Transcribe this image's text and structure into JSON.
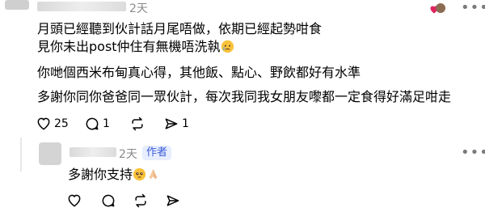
{
  "comment": {
    "time": "2天",
    "lines": [
      "月頭已經聽到伙計話月尾唔做，依期已經起勢咁食",
      "見你未出post仲住有無機唔洗執",
      "你哋個西米布甸真心得，其他飯、點心、野飲都好有水準",
      "多謝你同你爸爸同一眾伙計，每次我同我女朋友嚟都一定食得好滿足咁走"
    ],
    "likes": "25",
    "replies": "1",
    "shares": "1"
  },
  "reply": {
    "time": "2天",
    "badge": "作者",
    "text": "多謝你支持"
  },
  "icons": {
    "like": "heart-outline-icon",
    "comment": "speech-bubble-icon",
    "repost": "repost-arrows-icon",
    "share": "send-arrow-icon",
    "more": "more-horizontal-icon"
  },
  "colors": {
    "author_badge_bg": "#e6eeff",
    "author_badge_text": "#3c5bd6",
    "liked_heart": "#e0245e"
  }
}
